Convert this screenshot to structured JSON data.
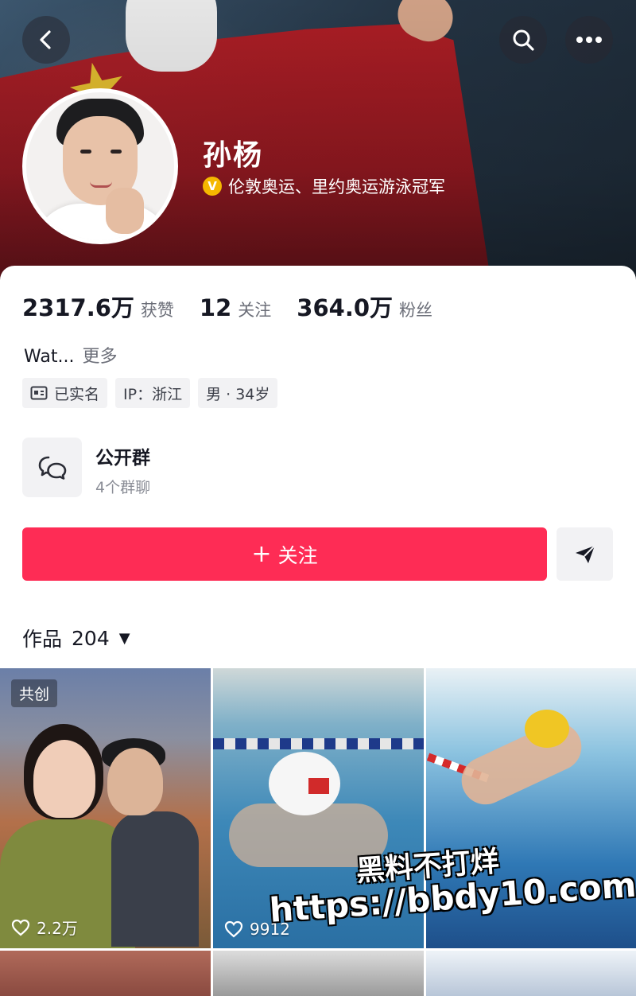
{
  "header": {
    "back_icon": "back-chevron-icon",
    "search_icon": "search-icon",
    "more_icon": "more-icon"
  },
  "profile": {
    "name": "孙杨",
    "verified_badge": "V",
    "verified_text": "伦敦奥运、里约奥运游泳冠军"
  },
  "stats": [
    {
      "value": "2317.6万",
      "label": "获赞"
    },
    {
      "value": "12",
      "label": "关注"
    },
    {
      "value": "364.0万",
      "label": "粉丝"
    }
  ],
  "bio": {
    "text": "Wat...",
    "more": "更多"
  },
  "tags": [
    {
      "icon": "id-card-icon",
      "label": "已实名"
    },
    {
      "label": "IP：浙江"
    },
    {
      "label": "男 · 34岁"
    }
  ],
  "group": {
    "icon": "group-chat-icon",
    "title": "公开群",
    "subtitle": "4个群聊"
  },
  "actions": {
    "follow_plus": "+",
    "follow_label": "关注",
    "share_icon": "share-icon"
  },
  "works": {
    "label": "作品",
    "count": "204",
    "caret": "▼"
  },
  "videos": [
    {
      "badge": "共创",
      "likes": "2.2万"
    },
    {
      "likes": "9912"
    },
    {
      "likes": ""
    }
  ],
  "watermark": {
    "line1": "黑料不打烊",
    "line2": "https://bbdy10.com"
  },
  "colors": {
    "accent": "#fe2c55",
    "verified": "#f5b800"
  }
}
